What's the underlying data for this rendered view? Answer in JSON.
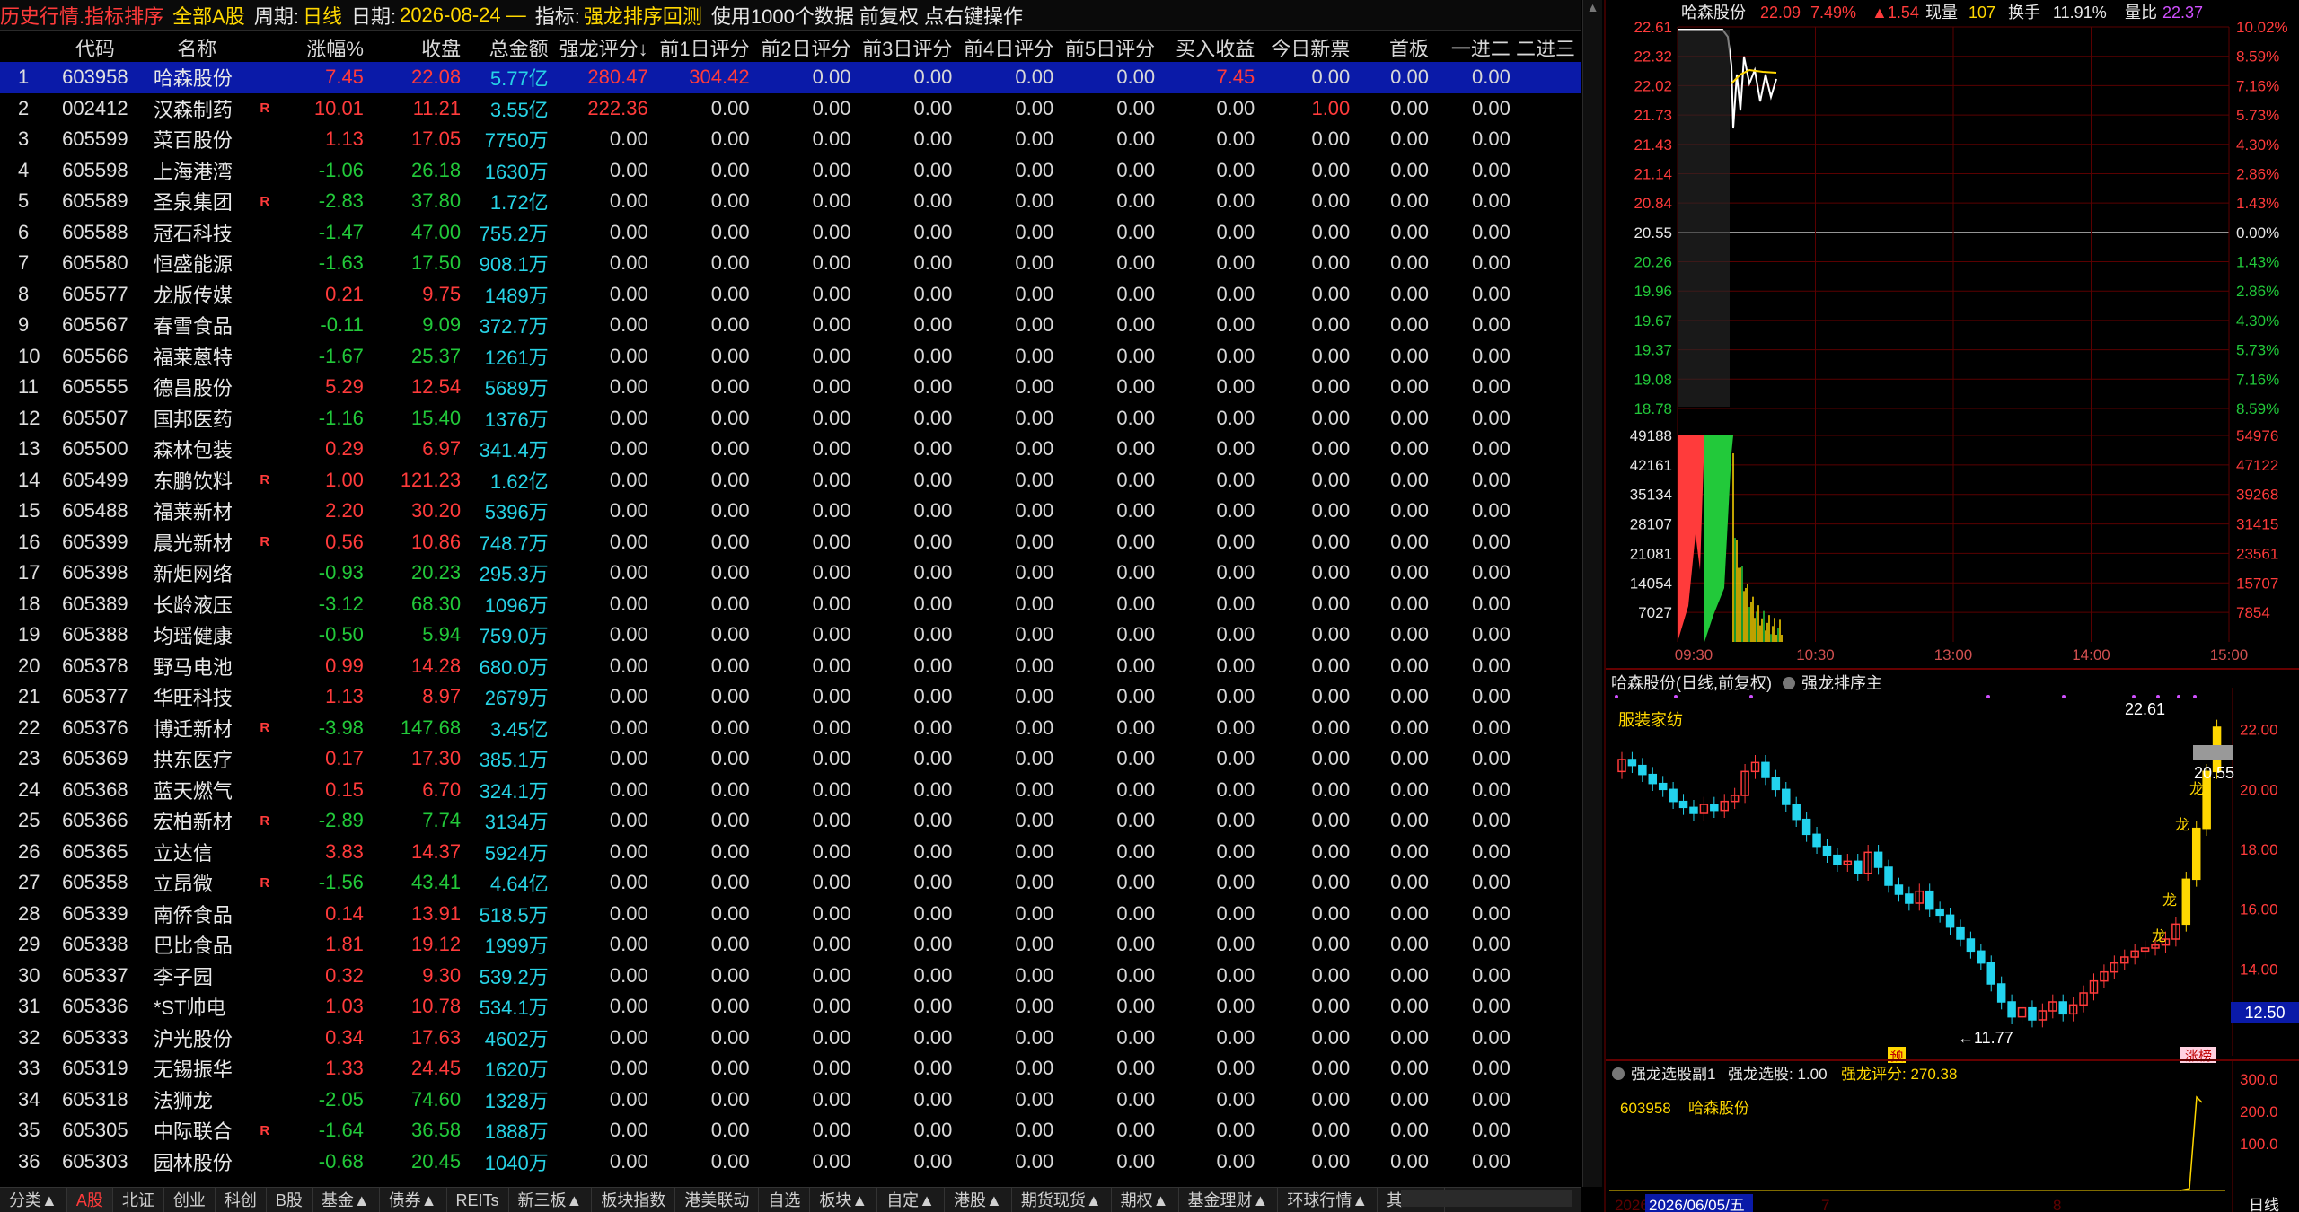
{
  "topbar": {
    "title": "历史行情.指标排序",
    "market": "全部A股",
    "period_label": "周期:",
    "period_value": "日线",
    "date_label": "日期:",
    "date_value": "2026-08-24 —",
    "indicator_label": "指标:",
    "indicator_value": "强龙排序回测",
    "note": "使用1000个数据 前复权 点右键操作"
  },
  "table": {
    "headers": [
      "",
      "代码",
      "名称",
      "",
      "涨幅%",
      "收盘",
      "总金额",
      "强龙评分↓",
      "前1日评分",
      "前2日评分",
      "前3日评分",
      "前4日评分",
      "前5日评分",
      "买入收益",
      "今日新票",
      "首板",
      "一进二",
      "二进三"
    ],
    "rows": [
      {
        "no": "1",
        "code": "603958",
        "name": "哈森股份",
        "r": "",
        "chg": "7.45",
        "close": "22.08",
        "amt": "5.77亿",
        "score": "280.47",
        "p1": "304.42",
        "p2": "0.00",
        "p3": "0.00",
        "p4": "0.00",
        "p5": "0.00",
        "buy": "7.45",
        "newt": "0.00",
        "first": "0.00",
        "j12": "0.00"
      },
      {
        "no": "2",
        "code": "002412",
        "name": "汉森制药",
        "r": "R",
        "chg": "10.01",
        "close": "11.21",
        "amt": "3.55亿",
        "score": "222.36",
        "p1": "0.00",
        "p2": "0.00",
        "p3": "0.00",
        "p4": "0.00",
        "p5": "0.00",
        "buy": "0.00",
        "newt": "1.00",
        "first": "0.00",
        "j12": "0.00"
      },
      {
        "no": "3",
        "code": "605599",
        "name": "菜百股份",
        "r": "",
        "chg": "1.13",
        "close": "17.05",
        "amt": "7750万",
        "score": "0.00",
        "p1": "0.00",
        "p2": "0.00",
        "p3": "0.00",
        "p4": "0.00",
        "p5": "0.00",
        "buy": "0.00",
        "newt": "0.00",
        "first": "0.00",
        "j12": "0.00"
      },
      {
        "no": "4",
        "code": "605598",
        "name": "上海港湾",
        "r": "",
        "chg": "-1.06",
        "close": "26.18",
        "amt": "1630万",
        "score": "0.00",
        "p1": "0.00",
        "p2": "0.00",
        "p3": "0.00",
        "p4": "0.00",
        "p5": "0.00",
        "buy": "0.00",
        "newt": "0.00",
        "first": "0.00",
        "j12": "0.00"
      },
      {
        "no": "5",
        "code": "605589",
        "name": "圣泉集团",
        "r": "R",
        "chg": "-2.83",
        "close": "37.80",
        "amt": "1.72亿",
        "score": "0.00",
        "p1": "0.00",
        "p2": "0.00",
        "p3": "0.00",
        "p4": "0.00",
        "p5": "0.00",
        "buy": "0.00",
        "newt": "0.00",
        "first": "0.00",
        "j12": "0.00"
      },
      {
        "no": "6",
        "code": "605588",
        "name": "冠石科技",
        "r": "",
        "chg": "-1.47",
        "close": "47.00",
        "amt": "755.2万",
        "score": "0.00",
        "p1": "0.00",
        "p2": "0.00",
        "p3": "0.00",
        "p4": "0.00",
        "p5": "0.00",
        "buy": "0.00",
        "newt": "0.00",
        "first": "0.00",
        "j12": "0.00"
      },
      {
        "no": "7",
        "code": "605580",
        "name": "恒盛能源",
        "r": "",
        "chg": "-1.63",
        "close": "17.50",
        "amt": "908.1万",
        "score": "0.00",
        "p1": "0.00",
        "p2": "0.00",
        "p3": "0.00",
        "p4": "0.00",
        "p5": "0.00",
        "buy": "0.00",
        "newt": "0.00",
        "first": "0.00",
        "j12": "0.00"
      },
      {
        "no": "8",
        "code": "605577",
        "name": "龙版传媒",
        "r": "",
        "chg": "0.21",
        "close": "9.75",
        "amt": "1489万",
        "score": "0.00",
        "p1": "0.00",
        "p2": "0.00",
        "p3": "0.00",
        "p4": "0.00",
        "p5": "0.00",
        "buy": "0.00",
        "newt": "0.00",
        "first": "0.00",
        "j12": "0.00"
      },
      {
        "no": "9",
        "code": "605567",
        "name": "春雪食品",
        "r": "",
        "chg": "-0.11",
        "close": "9.09",
        "amt": "372.7万",
        "score": "0.00",
        "p1": "0.00",
        "p2": "0.00",
        "p3": "0.00",
        "p4": "0.00",
        "p5": "0.00",
        "buy": "0.00",
        "newt": "0.00",
        "first": "0.00",
        "j12": "0.00"
      },
      {
        "no": "10",
        "code": "605566",
        "name": "福莱蒽特",
        "r": "",
        "chg": "-1.67",
        "close": "25.37",
        "amt": "1261万",
        "score": "0.00",
        "p1": "0.00",
        "p2": "0.00",
        "p3": "0.00",
        "p4": "0.00",
        "p5": "0.00",
        "buy": "0.00",
        "newt": "0.00",
        "first": "0.00",
        "j12": "0.00"
      },
      {
        "no": "11",
        "code": "605555",
        "name": "德昌股份",
        "r": "",
        "chg": "5.29",
        "close": "12.54",
        "amt": "5689万",
        "score": "0.00",
        "p1": "0.00",
        "p2": "0.00",
        "p3": "0.00",
        "p4": "0.00",
        "p5": "0.00",
        "buy": "0.00",
        "newt": "0.00",
        "first": "0.00",
        "j12": "0.00"
      },
      {
        "no": "12",
        "code": "605507",
        "name": "国邦医药",
        "r": "",
        "chg": "-1.16",
        "close": "15.40",
        "amt": "1376万",
        "score": "0.00",
        "p1": "0.00",
        "p2": "0.00",
        "p3": "0.00",
        "p4": "0.00",
        "p5": "0.00",
        "buy": "0.00",
        "newt": "0.00",
        "first": "0.00",
        "j12": "0.00"
      },
      {
        "no": "13",
        "code": "605500",
        "name": "森林包装",
        "r": "",
        "chg": "0.29",
        "close": "6.97",
        "amt": "341.4万",
        "score": "0.00",
        "p1": "0.00",
        "p2": "0.00",
        "p3": "0.00",
        "p4": "0.00",
        "p5": "0.00",
        "buy": "0.00",
        "newt": "0.00",
        "first": "0.00",
        "j12": "0.00"
      },
      {
        "no": "14",
        "code": "605499",
        "name": "东鹏饮料",
        "r": "R",
        "chg": "1.00",
        "close": "121.23",
        "amt": "1.62亿",
        "score": "0.00",
        "p1": "0.00",
        "p2": "0.00",
        "p3": "0.00",
        "p4": "0.00",
        "p5": "0.00",
        "buy": "0.00",
        "newt": "0.00",
        "first": "0.00",
        "j12": "0.00"
      },
      {
        "no": "15",
        "code": "605488",
        "name": "福莱新材",
        "r": "",
        "chg": "2.20",
        "close": "30.20",
        "amt": "5396万",
        "score": "0.00",
        "p1": "0.00",
        "p2": "0.00",
        "p3": "0.00",
        "p4": "0.00",
        "p5": "0.00",
        "buy": "0.00",
        "newt": "0.00",
        "first": "0.00",
        "j12": "0.00"
      },
      {
        "no": "16",
        "code": "605399",
        "name": "晨光新材",
        "r": "R",
        "chg": "0.56",
        "close": "10.86",
        "amt": "748.7万",
        "score": "0.00",
        "p1": "0.00",
        "p2": "0.00",
        "p3": "0.00",
        "p4": "0.00",
        "p5": "0.00",
        "buy": "0.00",
        "newt": "0.00",
        "first": "0.00",
        "j12": "0.00"
      },
      {
        "no": "17",
        "code": "605398",
        "name": "新炬网络",
        "r": "",
        "chg": "-0.93",
        "close": "20.23",
        "amt": "295.3万",
        "score": "0.00",
        "p1": "0.00",
        "p2": "0.00",
        "p3": "0.00",
        "p4": "0.00",
        "p5": "0.00",
        "buy": "0.00",
        "newt": "0.00",
        "first": "0.00",
        "j12": "0.00"
      },
      {
        "no": "18",
        "code": "605389",
        "name": "长龄液压",
        "r": "",
        "chg": "-3.12",
        "close": "68.30",
        "amt": "1096万",
        "score": "0.00",
        "p1": "0.00",
        "p2": "0.00",
        "p3": "0.00",
        "p4": "0.00",
        "p5": "0.00",
        "buy": "0.00",
        "newt": "0.00",
        "first": "0.00",
        "j12": "0.00"
      },
      {
        "no": "19",
        "code": "605388",
        "name": "均瑶健康",
        "r": "",
        "chg": "-0.50",
        "close": "5.94",
        "amt": "759.0万",
        "score": "0.00",
        "p1": "0.00",
        "p2": "0.00",
        "p3": "0.00",
        "p4": "0.00",
        "p5": "0.00",
        "buy": "0.00",
        "newt": "0.00",
        "first": "0.00",
        "j12": "0.00"
      },
      {
        "no": "20",
        "code": "605378",
        "name": "野马电池",
        "r": "",
        "chg": "0.99",
        "close": "14.28",
        "amt": "680.0万",
        "score": "0.00",
        "p1": "0.00",
        "p2": "0.00",
        "p3": "0.00",
        "p4": "0.00",
        "p5": "0.00",
        "buy": "0.00",
        "newt": "0.00",
        "first": "0.00",
        "j12": "0.00"
      },
      {
        "no": "21",
        "code": "605377",
        "name": "华旺科技",
        "r": "",
        "chg": "1.13",
        "close": "8.97",
        "amt": "2679万",
        "score": "0.00",
        "p1": "0.00",
        "p2": "0.00",
        "p3": "0.00",
        "p4": "0.00",
        "p5": "0.00",
        "buy": "0.00",
        "newt": "0.00",
        "first": "0.00",
        "j12": "0.00"
      },
      {
        "no": "22",
        "code": "605376",
        "name": "博迁新材",
        "r": "R",
        "chg": "-3.98",
        "close": "147.68",
        "amt": "3.45亿",
        "score": "0.00",
        "p1": "0.00",
        "p2": "0.00",
        "p3": "0.00",
        "p4": "0.00",
        "p5": "0.00",
        "buy": "0.00",
        "newt": "0.00",
        "first": "0.00",
        "j12": "0.00"
      },
      {
        "no": "23",
        "code": "605369",
        "name": "拱东医疗",
        "r": "",
        "chg": "0.17",
        "close": "17.30",
        "amt": "385.1万",
        "score": "0.00",
        "p1": "0.00",
        "p2": "0.00",
        "p3": "0.00",
        "p4": "0.00",
        "p5": "0.00",
        "buy": "0.00",
        "newt": "0.00",
        "first": "0.00",
        "j12": "0.00"
      },
      {
        "no": "24",
        "code": "605368",
        "name": "蓝天燃气",
        "r": "",
        "chg": "0.15",
        "close": "6.70",
        "amt": "324.1万",
        "score": "0.00",
        "p1": "0.00",
        "p2": "0.00",
        "p3": "0.00",
        "p4": "0.00",
        "p5": "0.00",
        "buy": "0.00",
        "newt": "0.00",
        "first": "0.00",
        "j12": "0.00"
      },
      {
        "no": "25",
        "code": "605366",
        "name": "宏柏新材",
        "r": "R",
        "chg": "-2.89",
        "close": "7.74",
        "amt": "3134万",
        "score": "0.00",
        "p1": "0.00",
        "p2": "0.00",
        "p3": "0.00",
        "p4": "0.00",
        "p5": "0.00",
        "buy": "0.00",
        "newt": "0.00",
        "first": "0.00",
        "j12": "0.00"
      },
      {
        "no": "26",
        "code": "605365",
        "name": "立达信",
        "r": "",
        "chg": "3.83",
        "close": "14.37",
        "amt": "5924万",
        "score": "0.00",
        "p1": "0.00",
        "p2": "0.00",
        "p3": "0.00",
        "p4": "0.00",
        "p5": "0.00",
        "buy": "0.00",
        "newt": "0.00",
        "first": "0.00",
        "j12": "0.00"
      },
      {
        "no": "27",
        "code": "605358",
        "name": "立昂微",
        "r": "R",
        "chg": "-1.56",
        "close": "43.41",
        "amt": "4.64亿",
        "score": "0.00",
        "p1": "0.00",
        "p2": "0.00",
        "p3": "0.00",
        "p4": "0.00",
        "p5": "0.00",
        "buy": "0.00",
        "newt": "0.00",
        "first": "0.00",
        "j12": "0.00"
      },
      {
        "no": "28",
        "code": "605339",
        "name": "南侨食品",
        "r": "",
        "chg": "0.14",
        "close": "13.91",
        "amt": "518.5万",
        "score": "0.00",
        "p1": "0.00",
        "p2": "0.00",
        "p3": "0.00",
        "p4": "0.00",
        "p5": "0.00",
        "buy": "0.00",
        "newt": "0.00",
        "first": "0.00",
        "j12": "0.00"
      },
      {
        "no": "29",
        "code": "605338",
        "name": "巴比食品",
        "r": "",
        "chg": "1.81",
        "close": "19.12",
        "amt": "1999万",
        "score": "0.00",
        "p1": "0.00",
        "p2": "0.00",
        "p3": "0.00",
        "p4": "0.00",
        "p5": "0.00",
        "buy": "0.00",
        "newt": "0.00",
        "first": "0.00",
        "j12": "0.00"
      },
      {
        "no": "30",
        "code": "605337",
        "name": "李子园",
        "r": "",
        "chg": "0.32",
        "close": "9.30",
        "amt": "539.2万",
        "score": "0.00",
        "p1": "0.00",
        "p2": "0.00",
        "p3": "0.00",
        "p4": "0.00",
        "p5": "0.00",
        "buy": "0.00",
        "newt": "0.00",
        "first": "0.00",
        "j12": "0.00"
      },
      {
        "no": "31",
        "code": "605336",
        "name": "*ST帅电",
        "r": "",
        "chg": "1.03",
        "close": "10.78",
        "amt": "534.1万",
        "score": "0.00",
        "p1": "0.00",
        "p2": "0.00",
        "p3": "0.00",
        "p4": "0.00",
        "p5": "0.00",
        "buy": "0.00",
        "newt": "0.00",
        "first": "0.00",
        "j12": "0.00"
      },
      {
        "no": "32",
        "code": "605333",
        "name": "沪光股份",
        "r": "",
        "chg": "0.34",
        "close": "17.63",
        "amt": "4602万",
        "score": "0.00",
        "p1": "0.00",
        "p2": "0.00",
        "p3": "0.00",
        "p4": "0.00",
        "p5": "0.00",
        "buy": "0.00",
        "newt": "0.00",
        "first": "0.00",
        "j12": "0.00"
      },
      {
        "no": "33",
        "code": "605319",
        "name": "无锡振华",
        "r": "",
        "chg": "1.33",
        "close": "24.45",
        "amt": "1620万",
        "score": "0.00",
        "p1": "0.00",
        "p2": "0.00",
        "p3": "0.00",
        "p4": "0.00",
        "p5": "0.00",
        "buy": "0.00",
        "newt": "0.00",
        "first": "0.00",
        "j12": "0.00"
      },
      {
        "no": "34",
        "code": "605318",
        "name": "法狮龙",
        "r": "",
        "chg": "-2.05",
        "close": "74.60",
        "amt": "1328万",
        "score": "0.00",
        "p1": "0.00",
        "p2": "0.00",
        "p3": "0.00",
        "p4": "0.00",
        "p5": "0.00",
        "buy": "0.00",
        "newt": "0.00",
        "first": "0.00",
        "j12": "0.00"
      },
      {
        "no": "35",
        "code": "605305",
        "name": "中际联合",
        "r": "R",
        "chg": "-1.64",
        "close": "36.58",
        "amt": "1888万",
        "score": "0.00",
        "p1": "0.00",
        "p2": "0.00",
        "p3": "0.00",
        "p4": "0.00",
        "p5": "0.00",
        "buy": "0.00",
        "newt": "0.00",
        "first": "0.00",
        "j12": "0.00"
      },
      {
        "no": "36",
        "code": "605303",
        "name": "园林股份",
        "r": "",
        "chg": "-0.68",
        "close": "20.45",
        "amt": "1040万",
        "score": "0.00",
        "p1": "0.00",
        "p2": "0.00",
        "p3": "0.00",
        "p4": "0.00",
        "p5": "0.00",
        "buy": "0.00",
        "newt": "0.00",
        "first": "0.00",
        "j12": "0.00"
      }
    ]
  },
  "tabs": [
    "分类▲",
    "A股",
    "北证",
    "创业",
    "科创",
    "B股",
    "基金▲",
    "债券▲",
    "REITs",
    "新三板▲",
    "板块指数",
    "港美联动",
    "自选",
    "板块▲",
    "自定▲",
    "港股▲",
    "期货现货▲",
    "期权▲",
    "基金理财▲",
    "环球行情▲",
    "其它▲"
  ],
  "active_tab": "A股",
  "intraday": {
    "header": {
      "name": "哈森股份",
      "price": "22.09",
      "pct": "7.49%",
      "chg": "▲1.54",
      "vol_label": "现量",
      "vol": "107",
      "turn_label": "换手",
      "turn": "11.91%",
      "ratio_label": "量比",
      "ratio": "22.37"
    },
    "price_ticks": [
      "22.61",
      "22.32",
      "22.02",
      "21.73",
      "21.43",
      "21.14",
      "20.84",
      "20.55",
      "20.26",
      "19.96",
      "19.67",
      "19.37",
      "19.08",
      "18.78"
    ],
    "pct_ticks": [
      "10.02%",
      "8.59%",
      "7.16%",
      "5.73%",
      "4.30%",
      "2.86%",
      "1.43%",
      "0.00%",
      "1.43%",
      "2.86%",
      "4.30%",
      "5.73%",
      "7.16%",
      "8.59%"
    ],
    "vol_ticks_left": [
      "49188",
      "42161",
      "35134",
      "28107",
      "21081",
      "14054",
      "7027"
    ],
    "vol_ticks_right": [
      "54976",
      "47122",
      "39268",
      "31415",
      "23561",
      "15707",
      "7854"
    ],
    "time_ticks": [
      "09:30",
      "10:30",
      "13:00",
      "14:00",
      "15:00"
    ],
    "colors": {
      "up": "#ff3b3b",
      "down": "#22c93a",
      "grid": "#5a0000",
      "price_line": "#ffffff",
      "avg_line": "#ffd700"
    }
  },
  "kline": {
    "title": "哈森股份(日线,前复权)",
    "indicator": "强龙排序主",
    "industry": "服装家纺",
    "y_ticks": [
      "22.00",
      "20.00",
      "18.00",
      "16.00",
      "14.00"
    ],
    "high_label": "22.61",
    "low_label": "←11.77",
    "last_label": "20.55",
    "cursor_label": "12.50",
    "marks": [
      "龙",
      "龙",
      "龙",
      "龙"
    ],
    "pre_badge": "预",
    "limit_badge": "涨榜",
    "chart_data": {
      "type": "candlestick",
      "close": [
        21.0,
        20.8,
        20.5,
        20.2,
        20.0,
        19.6,
        19.4,
        19.2,
        19.5,
        19.3,
        19.6,
        19.8,
        20.6,
        20.9,
        20.4,
        20.0,
        19.5,
        19.0,
        18.5,
        18.1,
        17.8,
        17.5,
        17.6,
        17.2,
        17.9,
        17.4,
        16.8,
        16.5,
        16.2,
        16.6,
        16.0,
        15.8,
        15.4,
        15.0,
        14.6,
        14.2,
        13.5,
        12.9,
        12.4,
        12.7,
        12.3,
        12.6,
        12.9,
        12.5,
        12.8,
        13.2,
        13.6,
        13.9,
        14.2,
        14.4,
        14.6,
        14.7,
        14.8,
        15.0,
        15.5,
        17.0,
        18.7,
        20.6,
        22.08
      ],
      "open": [
        20.6,
        21.0,
        20.8,
        20.5,
        20.2,
        20.0,
        19.6,
        19.4,
        19.2,
        19.5,
        19.3,
        19.6,
        19.8,
        20.6,
        20.9,
        20.4,
        20.0,
        19.5,
        19.0,
        18.5,
        18.1,
        17.8,
        17.5,
        17.6,
        17.2,
        17.9,
        17.4,
        16.8,
        16.5,
        16.2,
        16.6,
        16.0,
        15.8,
        15.4,
        15.0,
        14.6,
        14.2,
        13.5,
        12.9,
        12.4,
        12.7,
        12.3,
        12.6,
        12.9,
        12.5,
        12.8,
        13.2,
        13.6,
        13.9,
        14.2,
        14.4,
        14.6,
        14.7,
        14.8,
        15.0,
        15.5,
        17.0,
        18.7,
        20.6
      ],
      "ylim": [
        12.0,
        22.8
      ]
    }
  },
  "indic": {
    "title": "强龙选股副1",
    "label1": "强龙选股: 1.00",
    "label2": "强龙评分: 270.38",
    "code": "603958",
    "name": "哈森股份",
    "y_ticks": [
      "300.0",
      "200.0",
      "100.0"
    ],
    "date_label": "2026/06/05/五",
    "x_marks": [
      "2026",
      "7",
      "8"
    ],
    "period": "日线"
  }
}
